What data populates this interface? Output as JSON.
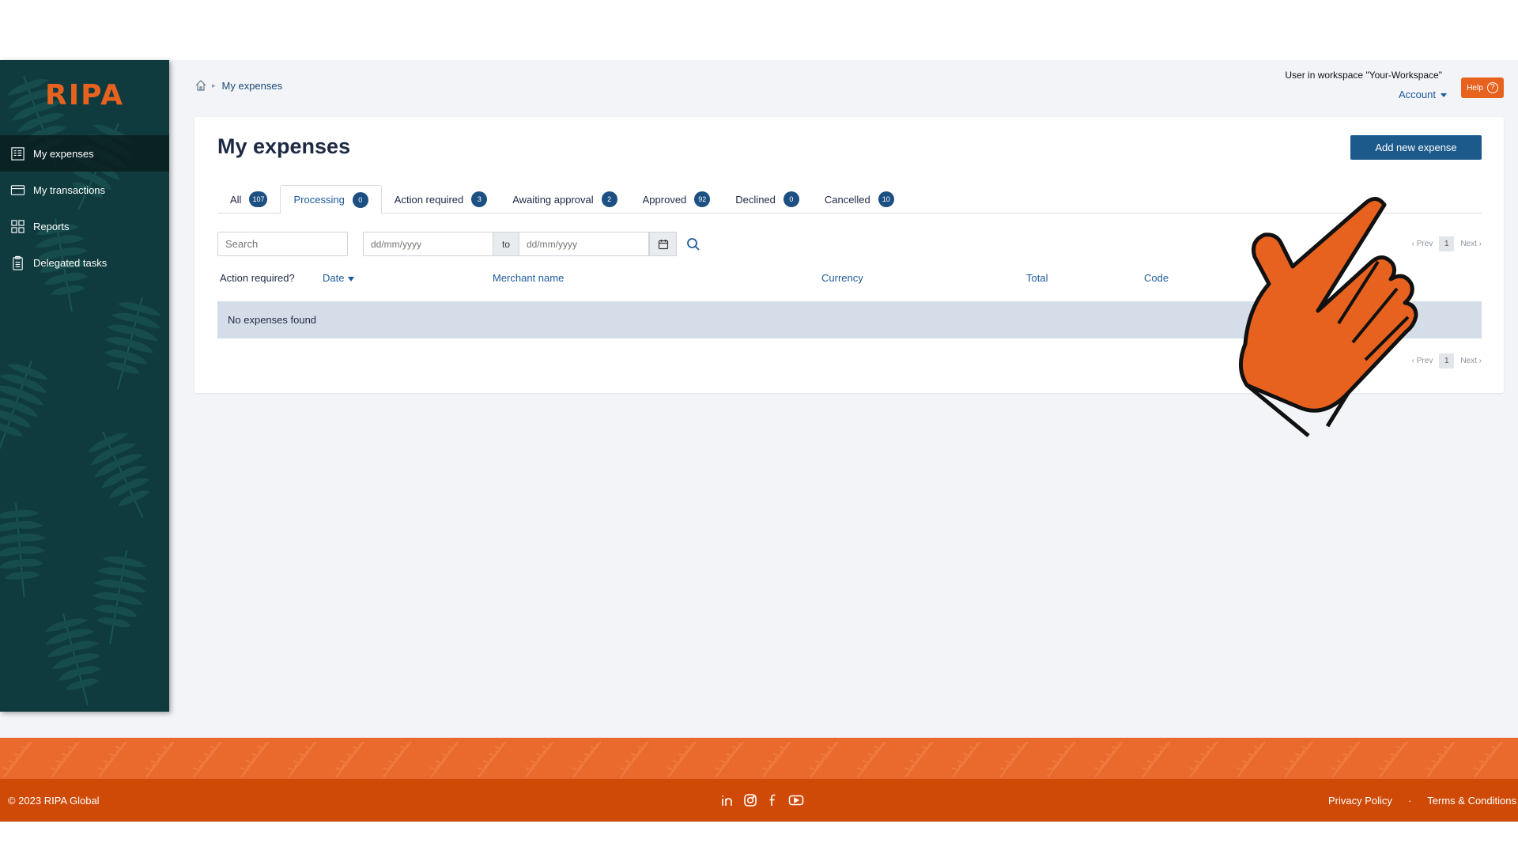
{
  "sidebar": {
    "logo": "RIPA",
    "items": [
      {
        "label": "My expenses",
        "icon": "receipt-icon",
        "active": true
      },
      {
        "label": "My transactions",
        "icon": "card-icon",
        "active": false
      },
      {
        "label": "Reports",
        "icon": "grid-icon",
        "active": false
      },
      {
        "label": "Delegated tasks",
        "icon": "clipboard-icon",
        "active": false
      }
    ]
  },
  "header": {
    "breadcrumb": {
      "current": "My expenses"
    },
    "user_info": "User in workspace \"Your-Workspace\"",
    "account_label": "Account",
    "help_label": "Help"
  },
  "main": {
    "title": "My expenses",
    "add_button": "Add new expense",
    "tabs": [
      {
        "label": "All",
        "count": "107"
      },
      {
        "label": "Processing",
        "count": "0",
        "active": true
      },
      {
        "label": "Action required",
        "count": "3"
      },
      {
        "label": "Awaiting approval",
        "count": "2"
      },
      {
        "label": "Approved",
        "count": "92"
      },
      {
        "label": "Declined",
        "count": "0"
      },
      {
        "label": "Cancelled",
        "count": "10"
      }
    ],
    "filters": {
      "search_placeholder": "Search",
      "date_from_placeholder": "dd/mm/yyyy",
      "to_label": "to",
      "date_to_placeholder": "dd/mm/yyyy"
    },
    "pagination": {
      "prev": "‹ Prev",
      "page": "1",
      "next": "Next ›"
    },
    "columns": [
      "Action required?",
      "Date",
      "Merchant name",
      "Currency",
      "Total",
      "Code"
    ],
    "empty_message": "No expenses found"
  },
  "footer": {
    "copyright": "© 2023 RIPA Global",
    "social_icons": [
      "linkedin-icon",
      "instagram-icon",
      "facebook-icon",
      "youtube-icon"
    ],
    "links": {
      "privacy": "Privacy Policy",
      "separator": "·",
      "terms": "Terms & Conditions"
    }
  },
  "colors": {
    "brand_orange": "#e8621f",
    "footer_orange": "#cf4a07",
    "sidebar_green": "#0f3b3e",
    "primary_blue": "#1c5a8c",
    "badge_blue": "#1c4f82"
  }
}
